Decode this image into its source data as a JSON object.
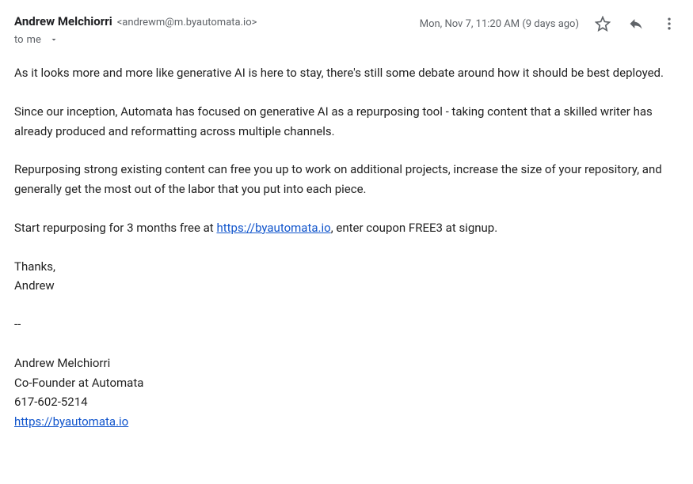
{
  "header": {
    "sender_name": "Andrew Melchiorri",
    "sender_email": "<andrewm@m.byautomata.io>",
    "recipient_prefix": "to",
    "recipient": "me",
    "timestamp": "Mon, Nov 7, 11:20 AM (9 days ago)"
  },
  "body": {
    "p1": "As it looks more and more like generative AI is here to stay, there's still some debate around how it should be best deployed.",
    "p2": "Since our inception, Automata has focused on generative AI as a repurposing tool - taking content that a skilled writer has already produced and reformatting across multiple channels.",
    "p3": "Repurposing strong existing content can free you up to work on additional projects, increase the size of your repository, and generally get the most out of the labor that you put into each piece.",
    "p4_pre": "Start repurposing for 3 months free at ",
    "p4_link": "https://byautomata.io",
    "p4_post": ", enter coupon FREE3 at signup.",
    "thanks": "Thanks,",
    "thanks_name": "Andrew",
    "divider": "--",
    "sig_name": "Andrew Melchiorri",
    "sig_title": "Co-Founder at Automata",
    "sig_phone": "617-602-5214",
    "sig_link": "https://byautomata.io"
  }
}
